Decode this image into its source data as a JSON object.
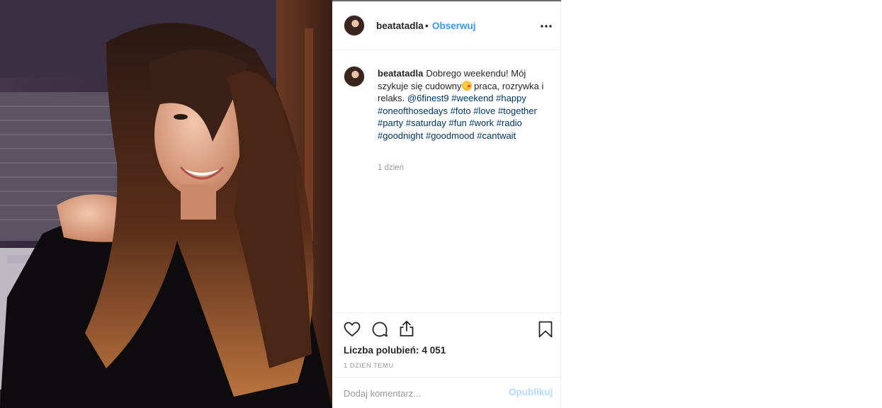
{
  "post": {
    "username": "beatatadla",
    "separator": "•",
    "follow_label": "Obserwuj",
    "more_icon": "more-horizontal-icon"
  },
  "caption": {
    "username": "beatatadla",
    "text_before_emoji": "Dobrego weekendu! Mój szykuje się cudowny",
    "emoji": "face-blowing-kiss",
    "text_after_emoji": " praca, rozrywka i relaks. ",
    "mention": "@6finest9",
    "hashtags": [
      "#weekend",
      "#happy",
      "#oneofthosedays",
      "#foto",
      "#love",
      "#together",
      "#party",
      "#saturday",
      "#fun",
      "#work",
      "#radio",
      "#goodnight",
      "#goodmood",
      "#cantwait"
    ],
    "time_ago": "1 dzień"
  },
  "actions": {
    "like_icon": "heart-icon",
    "comment_icon": "comment-icon",
    "share_icon": "share-icon",
    "save_icon": "bookmark-icon",
    "likes_label": "Liczba polubień:",
    "likes_count": "4 051",
    "date": "1 DZIEŃ TEMU"
  },
  "comment": {
    "placeholder": "Dodaj komentarz...",
    "publish_label": "Opublikuj"
  },
  "colors": {
    "link_blue": "#3897f0",
    "hashtag": "#003569",
    "muted": "#999999",
    "disabled_blue": "#b3dbff"
  }
}
